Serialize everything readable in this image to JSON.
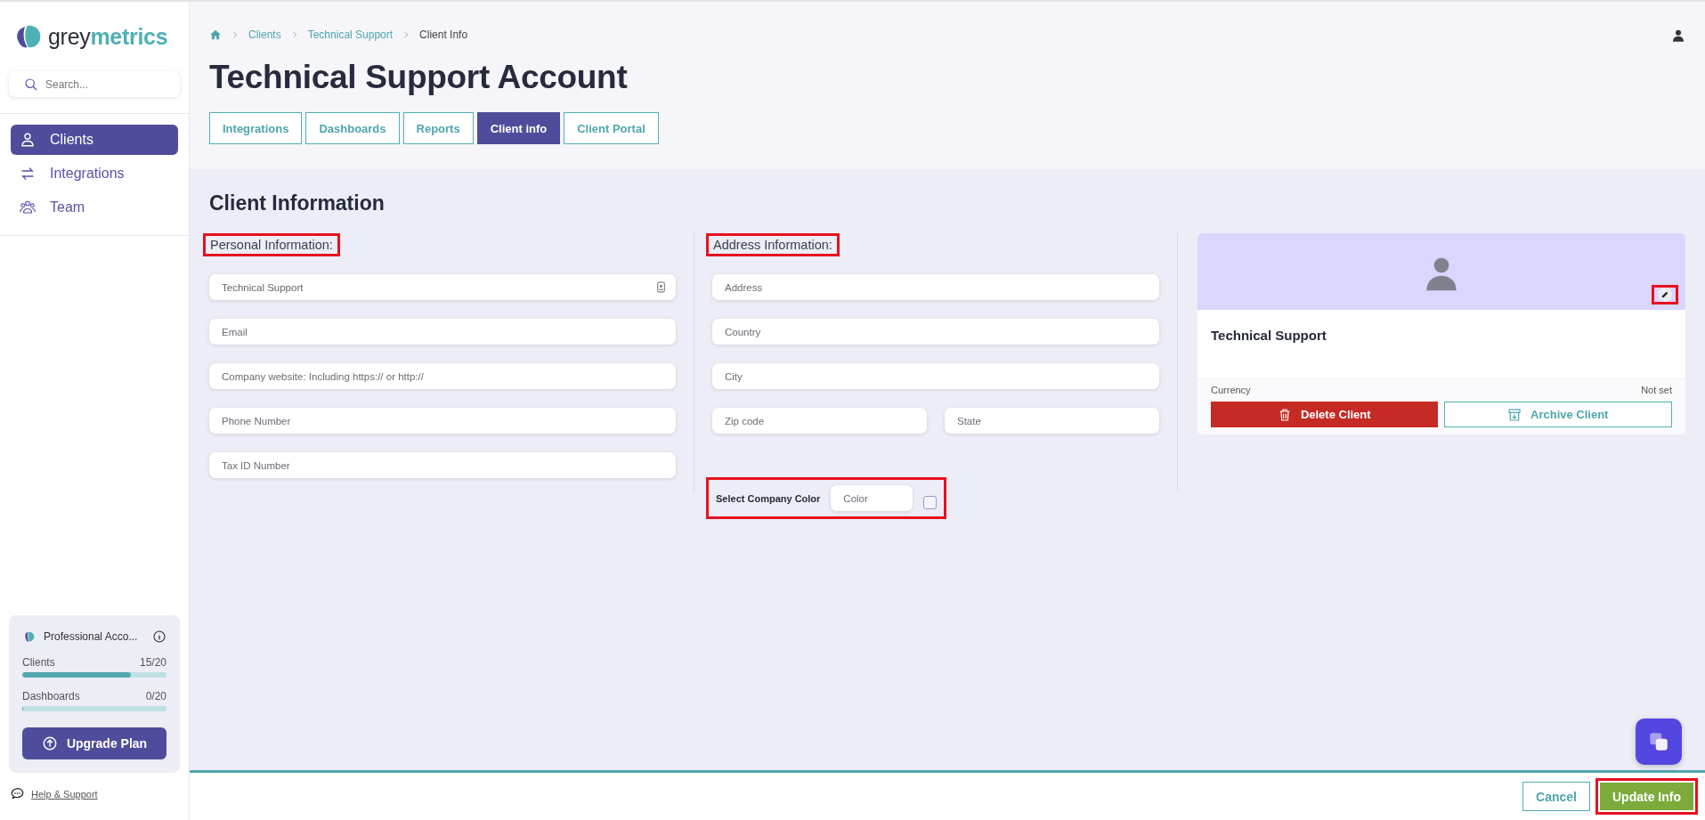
{
  "sidebar": {
    "brand": {
      "part_1": "grey",
      "part_2": "metrics"
    },
    "search": {
      "placeholder": "Search..."
    },
    "nav": [
      {
        "label": "Clients",
        "kind": "person",
        "selected": true
      },
      {
        "label": "Integrations",
        "kind": "arrows",
        "selected": false
      },
      {
        "label": "Team",
        "kind": "group",
        "selected": false
      }
    ],
    "plan": {
      "name": "Professional Acco...",
      "meters": [
        {
          "label": "Clients",
          "reading": "15/20",
          "level": 0.75
        },
        {
          "label": "Dashboards",
          "reading": "0/20",
          "level": 0
        }
      ],
      "upgrade_button": "Upgrade Plan"
    },
    "help_link": "Help & Support"
  },
  "breadcrumb": [
    {
      "label": "Clients",
      "kind": "link"
    },
    {
      "label": "Technical Support",
      "kind": "link"
    },
    {
      "label": "Client Info",
      "kind": "current"
    }
  ],
  "title": "Technical Support Account",
  "tabs": [
    {
      "label": "Integrations",
      "selected": false
    },
    {
      "label": "Dashboards",
      "selected": false
    },
    {
      "label": "Reports",
      "selected": false
    },
    {
      "label": "Client info",
      "selected": true
    },
    {
      "label": "Client Portal",
      "selected": false
    }
  ],
  "section_title": "Client Information",
  "personal": {
    "heading": "Personal Information:",
    "highlighted": true,
    "fields": [
      {
        "value": "Technical Support",
        "kind": "contact"
      },
      {
        "placeholder": "Email",
        "kind": "text"
      },
      {
        "placeholder": "Company website: Including https:// or http://",
        "kind": "text"
      },
      {
        "placeholder": "Phone Number",
        "kind": "text"
      },
      {
        "placeholder": "Tax ID Number",
        "kind": "text"
      }
    ]
  },
  "address": {
    "heading": "Address Information:",
    "highlighted": true,
    "rows": [
      [
        {
          "placeholder": "Address"
        }
      ],
      [
        {
          "placeholder": "Country"
        }
      ],
      [
        {
          "placeholder": "City"
        }
      ],
      [
        {
          "placeholder": "Zip code"
        },
        {
          "placeholder": "State"
        }
      ]
    ]
  },
  "color_picker": {
    "label": "Select Company Color",
    "placeholder": "Color",
    "checked": false,
    "highlighted": true
  },
  "card": {
    "name": "Technical Support",
    "edit_highlighted": true,
    "currency_label": "Currency",
    "currency_value": "Not set",
    "delete_button": "Delete Client",
    "archive_button": "Archive Client"
  },
  "footer": {
    "cancel_button": "Cancel",
    "update_button": "Update Info",
    "update_highlighted": true
  }
}
